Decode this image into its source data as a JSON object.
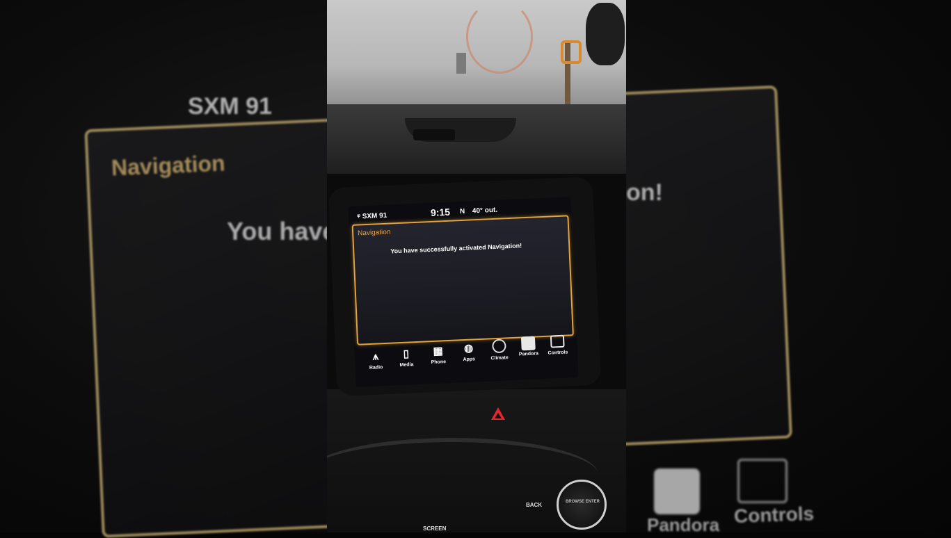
{
  "background_zoom": {
    "status_text": "SXM 91",
    "title": "Navigation",
    "message_left_fragment": "You have",
    "message_right_fragment": "on!",
    "dock_labels": [
      "Pandora",
      "Controls"
    ]
  },
  "screen": {
    "status_bar": {
      "radio": "SXM 91",
      "time": "9:15",
      "direction": "N",
      "temperature": "40° out."
    },
    "panel": {
      "title": "Navigation",
      "message": "You have successfully activated Navigation!"
    },
    "dock": [
      {
        "label": "Radio",
        "icon": "radio-tower-icon"
      },
      {
        "label": "Media",
        "icon": "media-phone-icon"
      },
      {
        "label": "Phone",
        "icon": "phone-icon"
      },
      {
        "label": "Apps",
        "icon": "apps-icon"
      },
      {
        "label": "Climate",
        "icon": "climate-icon"
      },
      {
        "label": "Pandora",
        "icon": "pandora-icon"
      },
      {
        "label": "Controls",
        "icon": "controls-icon"
      }
    ]
  },
  "console": {
    "back_label": "BACK",
    "screen_label": "SCREEN",
    "knob_label": "BROWSE ENTER"
  },
  "colors": {
    "accent": "#e2a23c",
    "hazard": "#e3262a"
  }
}
